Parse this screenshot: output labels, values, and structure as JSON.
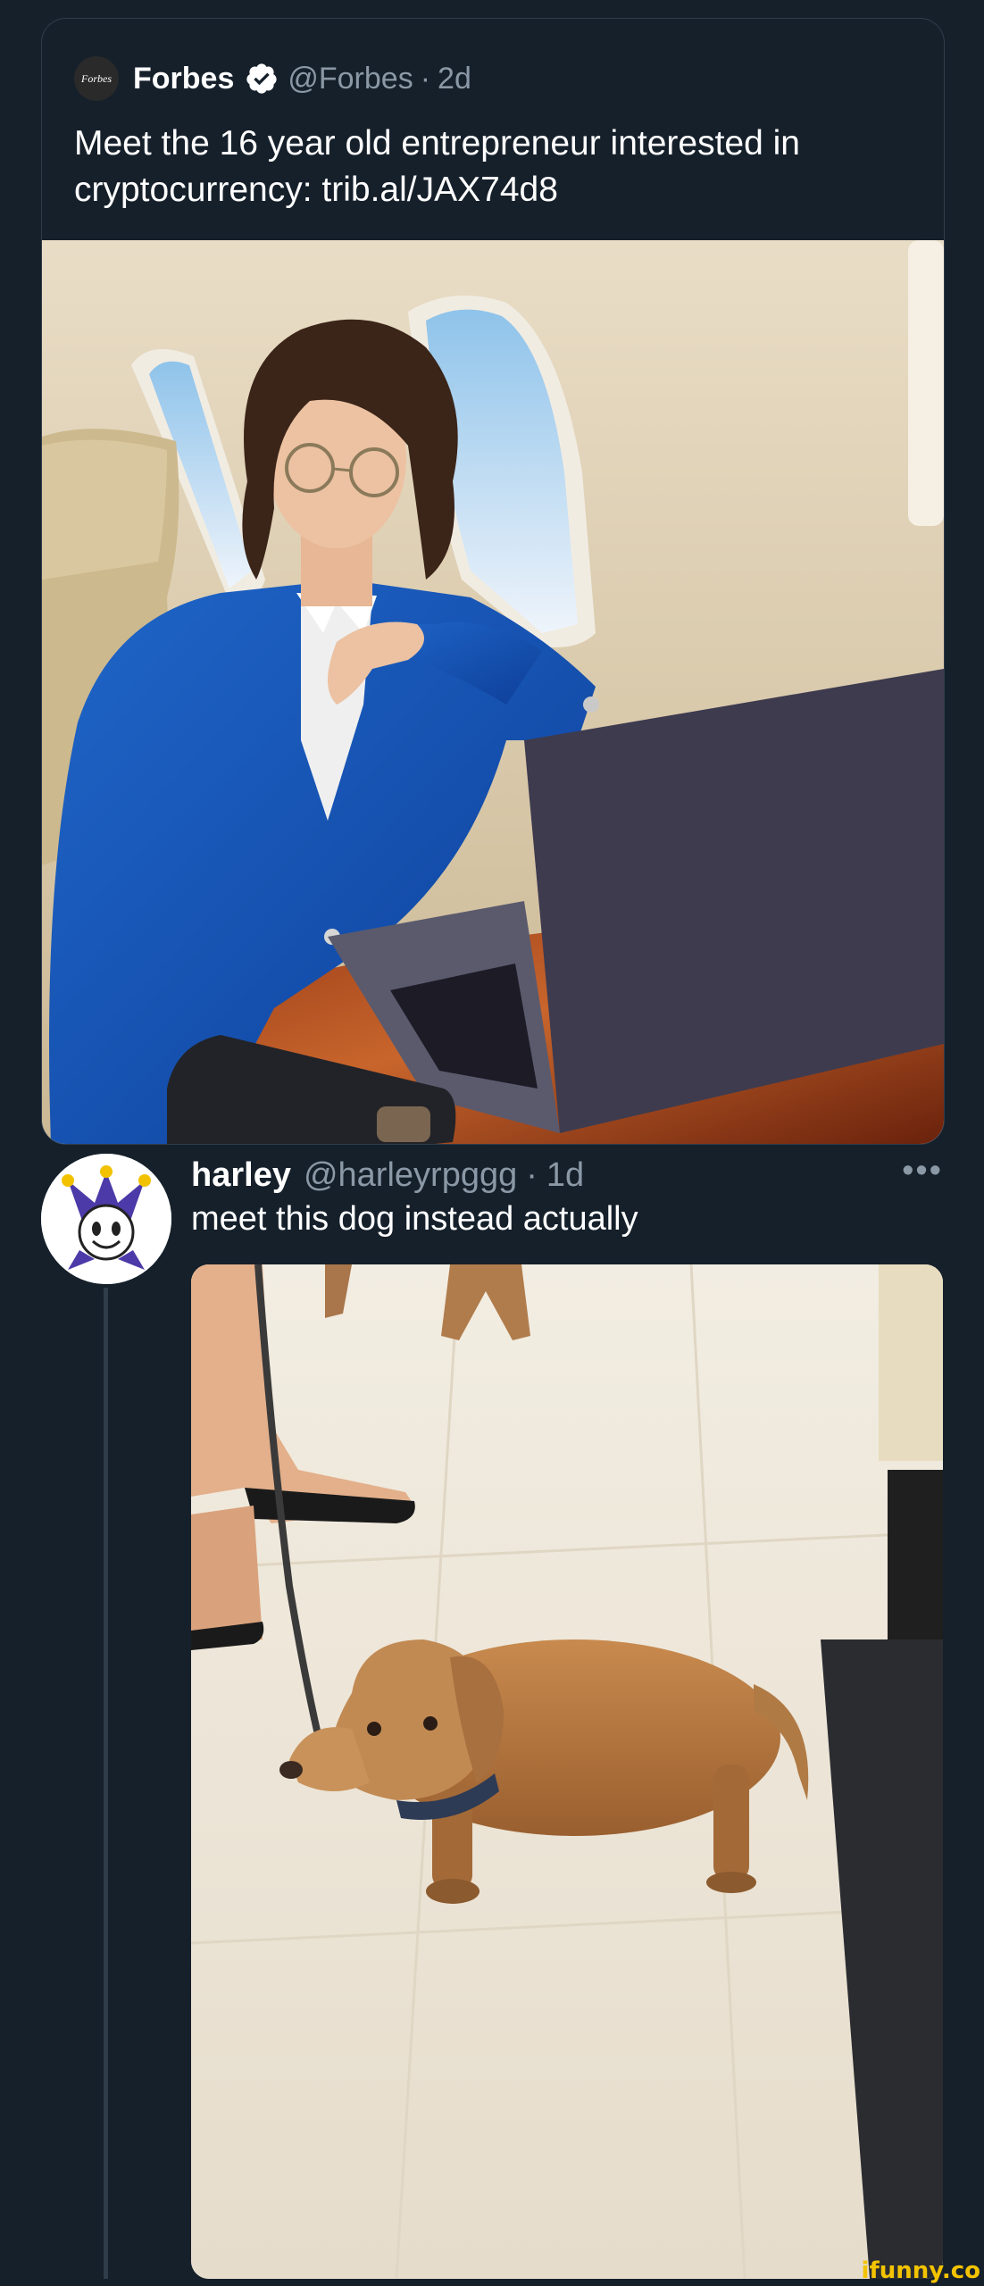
{
  "quoted_tweet": {
    "logo_text": "Forbes",
    "name": "Forbes",
    "handle": "@Forbes",
    "separator": "·",
    "time": "2d",
    "text": "Meet the 16 year old entrepreneur interested in cryptocurrency: trib.al/JAX74d8"
  },
  "reply": {
    "name": "harley",
    "handle": "@harleyrpggg",
    "separator": "·",
    "time": "1d",
    "text": "meet this dog instead actually",
    "more_label": "•••"
  },
  "watermark": "ifunny.co",
  "colors": {
    "background": "#15202b",
    "secondary_text": "#8b98a5",
    "verified_badge": "#ffffff",
    "watermark": "#f3c300"
  }
}
